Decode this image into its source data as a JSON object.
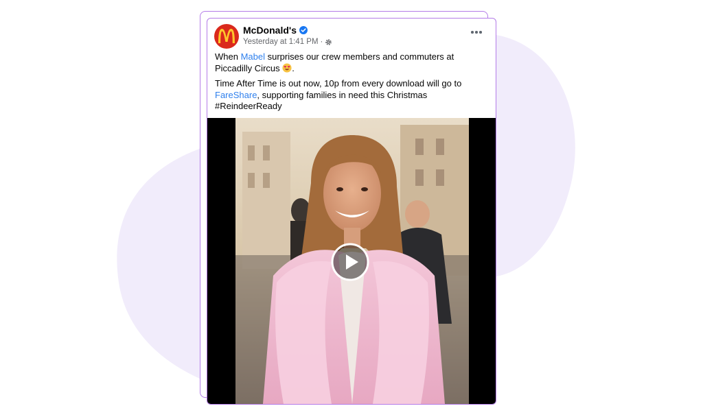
{
  "post": {
    "page_name": "McDonald's",
    "timestamp": "Yesterday at 1:41 PM",
    "separator": "·",
    "text_line1_before": "When ",
    "mention": "Mabel",
    "text_line1_after": " surprises our crew members and commuters at Piccadilly Circus ",
    "text_line1_end": ".",
    "text_para2_before": "Time After Time is out now, 10p from every download will go to ",
    "link_fareshare": "FareShare",
    "text_para2_after": ", supporting families in need this Christmas",
    "hashtag": "#ReindeerReady"
  },
  "icons": {
    "avatar": "mcdonalds-logo",
    "verified": "verified-badge-icon",
    "privacy": "gear-icon",
    "more": "more-options-icon",
    "emoji": "heart-eyes-emoji",
    "play": "play-icon"
  },
  "colors": {
    "accent": "#b37be8",
    "blob": "#f1ecfb",
    "link": "#2f80ed",
    "mcdonalds_red": "#da291c",
    "mcdonalds_yellow": "#ffc72c"
  }
}
